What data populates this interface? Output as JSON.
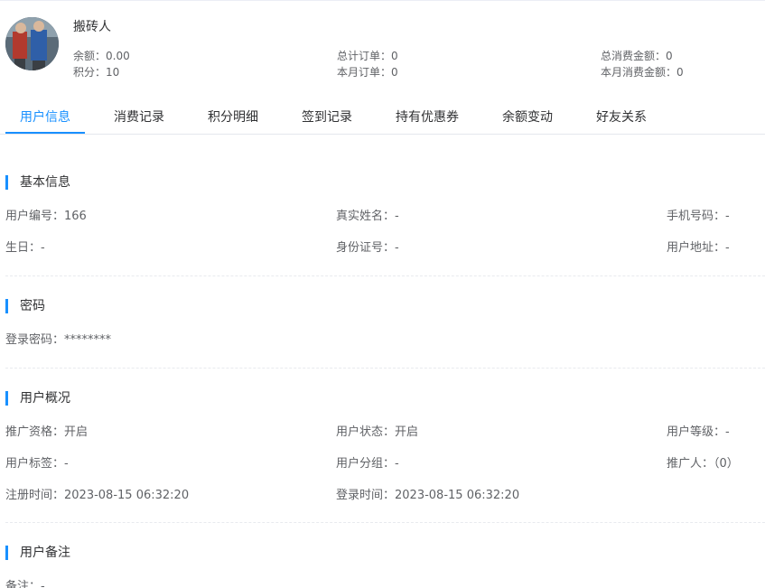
{
  "user": {
    "name": "搬砖人",
    "stats": [
      {
        "label": "余额：",
        "value": "0.00"
      },
      {
        "label": "积分：",
        "value": "10"
      },
      {
        "label": "总计订单：",
        "value": "0"
      },
      {
        "label": "本月订单：",
        "value": "0"
      },
      {
        "label": "总消费金额：",
        "value": "0"
      },
      {
        "label": "本月消费金额：",
        "value": "0"
      }
    ]
  },
  "tabs": [
    {
      "label": "用户信息",
      "active": true
    },
    {
      "label": "消费记录"
    },
    {
      "label": "积分明细"
    },
    {
      "label": "签到记录"
    },
    {
      "label": "持有优惠券"
    },
    {
      "label": "余额变动"
    },
    {
      "label": "好友关系"
    }
  ],
  "sections": {
    "basic": {
      "title": "基本信息",
      "fields": [
        {
          "label": "用户编号：",
          "value": "166"
        },
        {
          "label": "真实姓名：",
          "value": "-"
        },
        {
          "label": "手机号码：",
          "value": "-"
        },
        {
          "label": "生日：",
          "value": "-"
        },
        {
          "label": "身份证号：",
          "value": "-"
        },
        {
          "label": "用户地址：",
          "value": "-"
        }
      ]
    },
    "password": {
      "title": "密码",
      "fields": [
        {
          "label": "登录密码：",
          "value": "********"
        }
      ]
    },
    "overview": {
      "title": "用户概况",
      "fields": [
        {
          "label": "推广资格：",
          "value": "开启"
        },
        {
          "label": "用户状态：",
          "value": "开启"
        },
        {
          "label": "用户等级：",
          "value": "-"
        },
        {
          "label": "用户标签：",
          "value": "-"
        },
        {
          "label": "用户分组：",
          "value": "-"
        },
        {
          "label": "推广人：",
          "value": "（0）"
        },
        {
          "label": "注册时间：",
          "value": "2023-08-15 06:32:20"
        },
        {
          "label": "登录时间：",
          "value": "2023-08-15 06:32:20"
        }
      ]
    },
    "remark": {
      "title": "用户备注",
      "fields": [
        {
          "label": "备注：",
          "value": "-"
        }
      ]
    }
  },
  "colors": {
    "accent": "#1890ff",
    "text_primary": "#303133",
    "text_regular": "#606266",
    "border": "#e4e7ed"
  }
}
